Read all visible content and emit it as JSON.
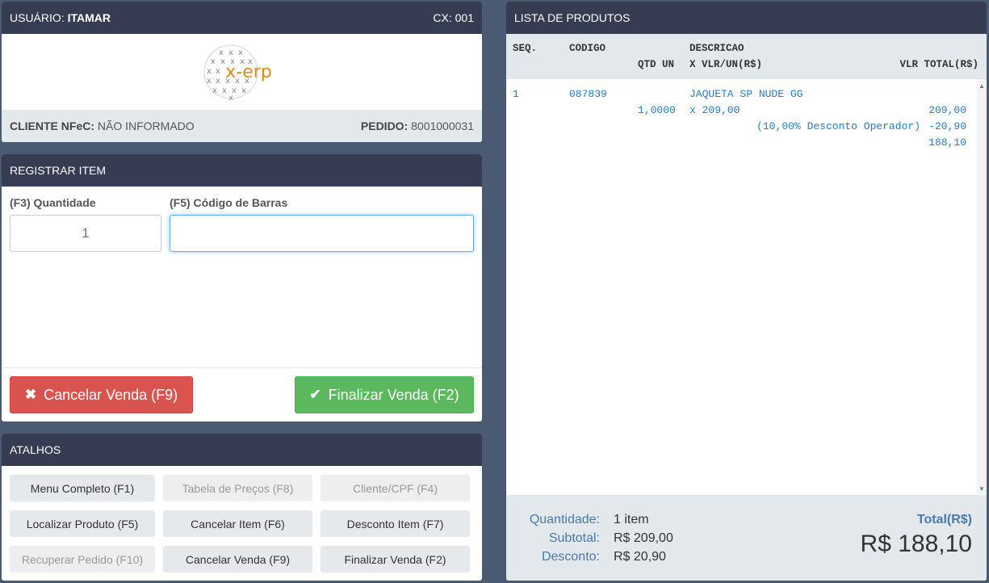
{
  "user_panel": {
    "user_label": "USUÁRIO:",
    "user_name": "ITAMAR",
    "register": "CX: 001",
    "logo_text": "x-erp",
    "client_label": "CLIENTE NFeC:",
    "client_value": "NÃO INFORMADO",
    "order_label": "PEDIDO:",
    "order_value": "8001000031"
  },
  "register_item": {
    "title": "REGISTRAR ITEM",
    "quantity_label": "(F3) Quantidade",
    "quantity_value": "1",
    "barcode_label": "(F5) Código de Barras",
    "barcode_value": "",
    "cancel_label": "Cancelar Venda (F9)",
    "finalize_label": "Finalizar Venda (F2)"
  },
  "shortcuts": {
    "title": "ATALHOS",
    "items": [
      {
        "label": "Menu Completo (F1)",
        "enabled": true
      },
      {
        "label": "Tabela de Preços (F8)",
        "enabled": false
      },
      {
        "label": "Cliente/CPF (F4)",
        "enabled": false
      },
      {
        "label": "Localizar Produto (F5)",
        "enabled": true
      },
      {
        "label": "Cancelar Item (F6)",
        "enabled": true
      },
      {
        "label": "Desconto Item (F7)",
        "enabled": true
      },
      {
        "label": "Recuperar Pedido (F10)",
        "enabled": false
      },
      {
        "label": "Cancelar Venda (F9)",
        "enabled": true
      },
      {
        "label": "Finalizar Venda (F2)",
        "enabled": true
      }
    ]
  },
  "product_list": {
    "title": "LISTA DE PRODUTOS",
    "headers": {
      "seq": "SEQ.",
      "code": "CODIGO",
      "description": "DESCRICAO",
      "qty_un": "QTD UN",
      "unit_price": "X VLR/UN(R$)",
      "total": "VLR TOTAL(R$)"
    },
    "items": [
      {
        "seq": "1",
        "code": "087839",
        "description": "JAQUETA SP NUDE GG",
        "qty": "1,0000",
        "unit_price": "x 209,00",
        "gross": "209,00",
        "discount_note": "(10,00% Desconto Operador)",
        "discount_value": "-20,90",
        "net": "188,10"
      }
    ]
  },
  "summary": {
    "quantity_label": "Quantidade:",
    "quantity_value": "1 item",
    "subtotal_label": "Subtotal:",
    "subtotal_value": "R$ 209,00",
    "discount_label": "Desconto:",
    "discount_value": "R$ 20,90",
    "total_label": "Total(R$)",
    "total_value": "R$ 188,10"
  },
  "colors": {
    "header_bg": "#363d52",
    "page_bg": "#4a5a72",
    "danger": "#d9534f",
    "success": "#5cb85c",
    "item_text": "#2a7bbf"
  }
}
